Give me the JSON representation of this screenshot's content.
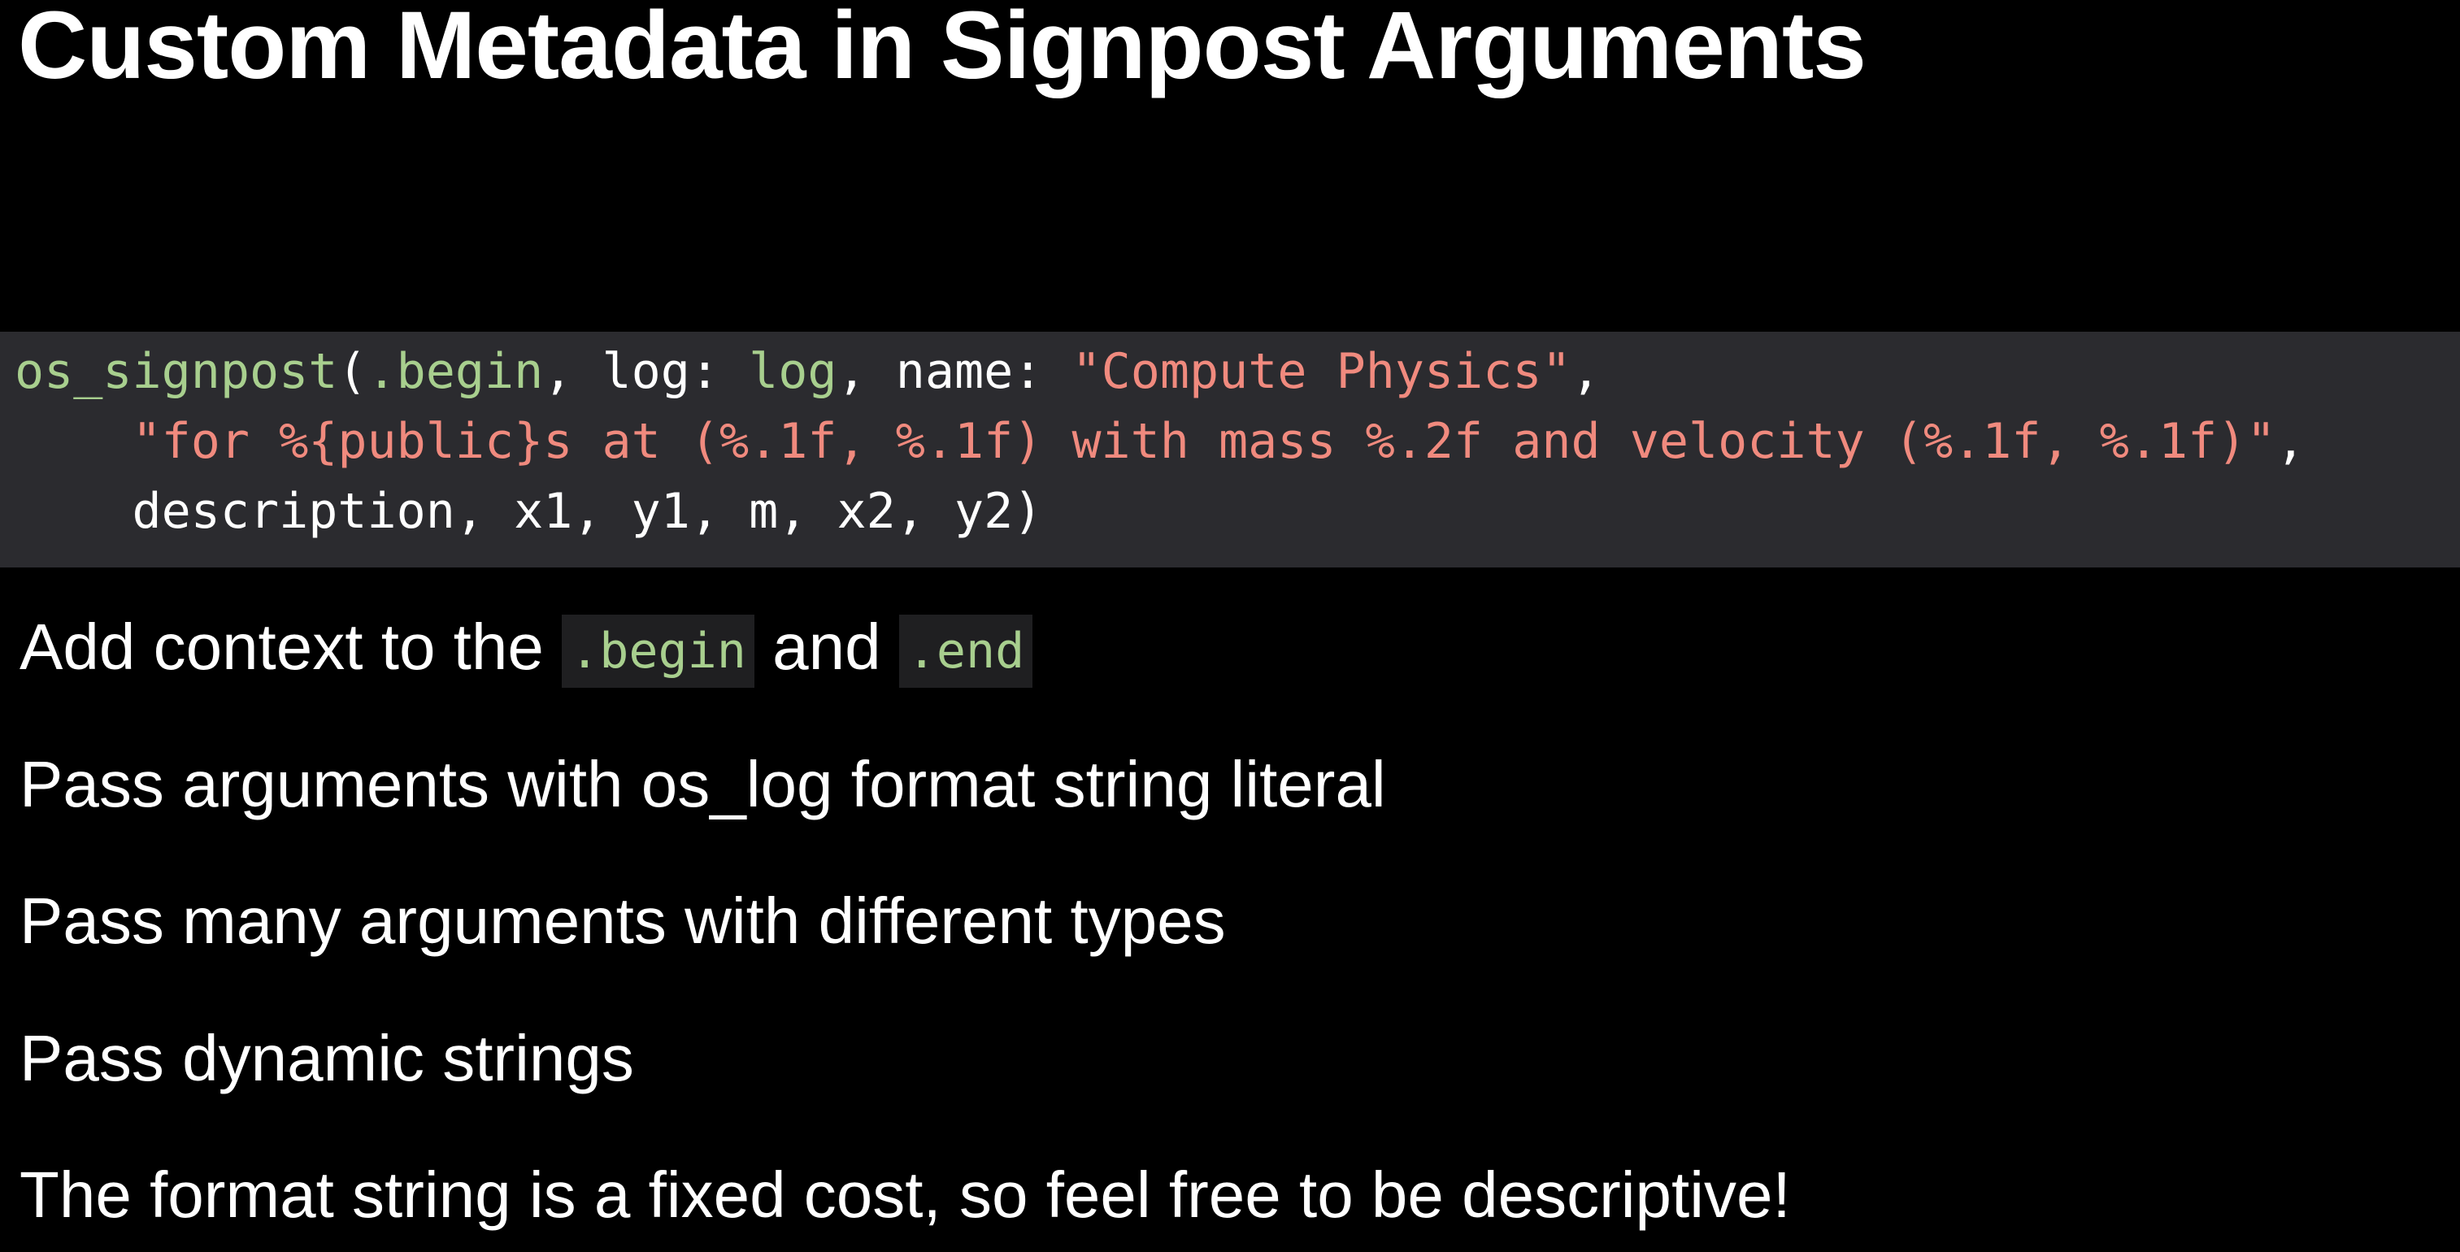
{
  "slide": {
    "title": "Custom Metadata in Signpost Arguments"
  },
  "code": {
    "line1": {
      "fn": "os_signpost",
      "paren_open": "(",
      "begin_kw": ".begin",
      "sep1": ", log: ",
      "log_val": "log",
      "sep2": ", name: ",
      "name_str": "\"Compute Physics\"",
      "trail": ","
    },
    "line2": {
      "indent": "    ",
      "format_str": "\"for %{public}s at (%.1f, %.1f) with mass %.2f and velocity (%.1f, %.1f)\"",
      "trail": ","
    },
    "line3": {
      "indent": "    ",
      "args": "description, x1, y1, m, x2, y2)"
    }
  },
  "bullets": {
    "b1": {
      "prefix": "Add context to the ",
      "code1": ".begin",
      "mid": " and ",
      "code2": ".end"
    },
    "b2": "Pass arguments with os_log format string literal",
    "b3": "Pass many arguments with different types",
    "b4": "Pass dynamic strings",
    "b5": "The format string is a fixed cost, so feel free to be descriptive!"
  },
  "colors": {
    "background": "#000000",
    "code_background": "#2b2b2f",
    "inline_code_background": "#1f1f21",
    "identifier_green": "#a8cf8e",
    "string_salmon": "#f08a7e",
    "text": "#ffffff"
  }
}
